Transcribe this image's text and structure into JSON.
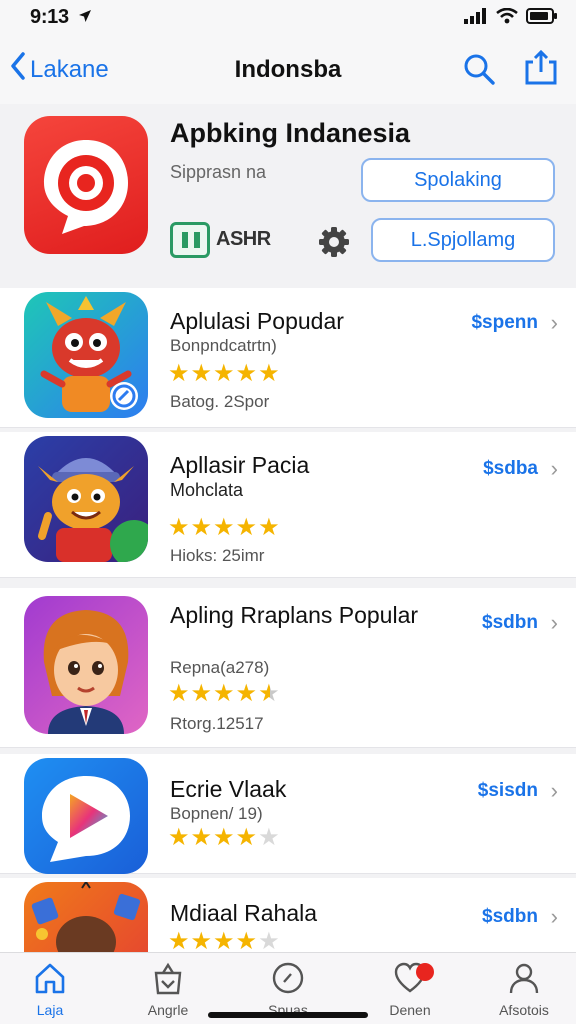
{
  "status_bar": {
    "time": "9:13"
  },
  "nav": {
    "back_label": "Lakane",
    "title": "Indonsba"
  },
  "header": {
    "app_title": "Apbking Indanesia",
    "subtitle": "Sipprasn na",
    "primary_button": "Spolaking",
    "secondary_button": "L.Spjollamg",
    "badge_text": "ASHR"
  },
  "apps": [
    {
      "name": "Aplulasi Popudar",
      "meta": "Bonpndcatrtn)",
      "footer": "Batog. 2Spor",
      "rating": 5,
      "price": "$spenn"
    },
    {
      "name": "Apllasir Pacia",
      "meta": "Mohclata",
      "footer": "Hioks: 25imr",
      "rating": 5,
      "price": "$sdba"
    },
    {
      "name": "Apling Rraplans Popular",
      "meta": "Repna(a278)",
      "footer": "Rtorg.12517",
      "rating": 4.5,
      "price": "$sdbn"
    },
    {
      "name": "Ecrie Vlaak",
      "meta": "Bopnen/ 19)",
      "footer": "",
      "rating": 4,
      "price": "$sisdn"
    },
    {
      "name": "Mdiaal Rahala",
      "meta": "",
      "footer": "",
      "rating": 4,
      "price": "$sdbn"
    }
  ],
  "tabs": [
    {
      "label": "Laja",
      "icon": "house-icon",
      "active": true
    },
    {
      "label": "Angrle",
      "icon": "bag-icon",
      "active": false
    },
    {
      "label": "Spuas",
      "icon": "compass-icon",
      "active": false
    },
    {
      "label": "Denen",
      "icon": "heart-icon",
      "active": false
    },
    {
      "label": "Afsotois",
      "icon": "person-icon",
      "active": false
    }
  ],
  "colors": {
    "accent": "#1a73e8",
    "star": "#f5b400",
    "hero_icon": "#e8251f"
  }
}
